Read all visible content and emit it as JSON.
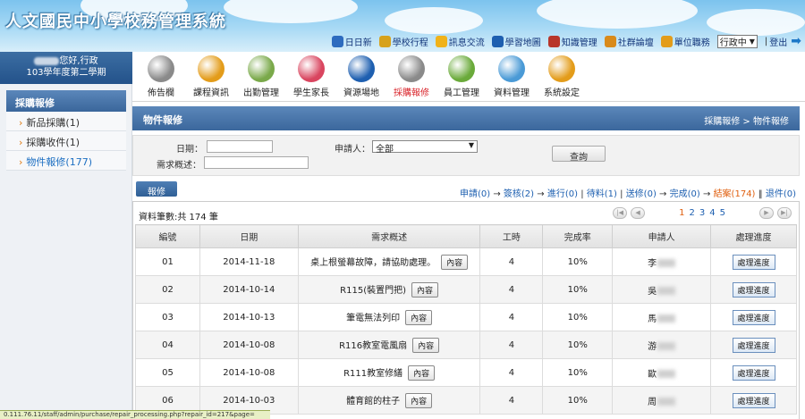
{
  "header": {
    "site_title": "人文國民中小學校務管理系統",
    "nav": [
      {
        "label": "日日新",
        "icon": "calendar-icon",
        "color": "#2d6bbf"
      },
      {
        "label": "學校行程",
        "icon": "school-schedule-icon",
        "color": "#d7a21c"
      },
      {
        "label": "訊息交流",
        "icon": "message-icon",
        "color": "#f0b21a"
      },
      {
        "label": "學習地圖",
        "icon": "globe-icon",
        "color": "#1e5fb0"
      },
      {
        "label": "知識管理",
        "icon": "book-icon",
        "color": "#b8362a"
      },
      {
        "label": "社群論壇",
        "icon": "pencil-icon",
        "color": "#d98a1a"
      },
      {
        "label": "單位職務",
        "icon": "gear-icon",
        "color": "#e39c1a"
      }
    ],
    "role_select": "行政中",
    "logout": "登出"
  },
  "user": {
    "greeting": "您好,行政",
    "semester": "103學年度第二學期"
  },
  "toolbar": [
    {
      "label": "佈告欄",
      "icon": "info-icon",
      "color": "#8a8a8a",
      "active": false
    },
    {
      "label": "課程資訊",
      "icon": "folder-icon",
      "color": "#e39c1a",
      "active": false
    },
    {
      "label": "出勤管理",
      "icon": "attendance-sheet-icon",
      "color": "#7aa94a",
      "active": false
    },
    {
      "label": "學生家長",
      "icon": "student-icon",
      "color": "#d9455f",
      "active": false
    },
    {
      "label": "資源場地",
      "icon": "globe-icon",
      "color": "#1e5fb0",
      "active": false
    },
    {
      "label": "採購報修",
      "icon": "wrench-icon",
      "color": "#8a8a8a",
      "active": true
    },
    {
      "label": "員工管理",
      "icon": "add-user-icon",
      "color": "#6aaa3a",
      "active": false
    },
    {
      "label": "資料管理",
      "icon": "computer-icon",
      "color": "#4a9ad6",
      "active": false
    },
    {
      "label": "系統設定",
      "icon": "gear-icon",
      "color": "#e39c1a",
      "active": false
    }
  ],
  "sidebar": {
    "heading": "採購報修",
    "items": [
      {
        "label": "新品採購(1)"
      },
      {
        "label": "採購收件(1)"
      },
      {
        "label": "物件報修(177)"
      }
    ]
  },
  "page": {
    "title": "物件報修",
    "breadcrumb": "採購報修 > 物件報修"
  },
  "search": {
    "date_label": "日期：",
    "desc_label": "需求概述：",
    "applicant_label": "申請人：",
    "applicant_value": "全部",
    "query_button": "查詢"
  },
  "actions": {
    "repair_button": "報修"
  },
  "flow": {
    "apply": "申請(0)",
    "review": "簽核(2)",
    "progress": "進行(0)",
    "pending": "待料(1)",
    "sent": "送修(0)",
    "complete": "完成(0)",
    "closed": "結案(174)",
    "returned": "退件(0)"
  },
  "list": {
    "count_text": "資料筆數:共 174 筆",
    "pages": [
      "1",
      "2",
      "3",
      "4",
      "5"
    ],
    "current_page": "1",
    "columns": [
      "編號",
      "日期",
      "需求概述",
      "工時",
      "完成率",
      "申請人",
      "處理進度"
    ],
    "detail_label": "內容",
    "process_label": "處理進度",
    "rows": [
      {
        "no": "01",
        "date": "2014-11-18",
        "desc": "桌上根螢幕故障，請協助處理。",
        "hours": "4",
        "rate": "10%",
        "applicant": "李"
      },
      {
        "no": "02",
        "date": "2014-10-14",
        "desc": "R115(裝置門把)",
        "hours": "4",
        "rate": "10%",
        "applicant": "吳"
      },
      {
        "no": "03",
        "date": "2014-10-13",
        "desc": "筆電無法列印",
        "hours": "4",
        "rate": "10%",
        "applicant": "馬"
      },
      {
        "no": "04",
        "date": "2014-10-08",
        "desc": "R116教室電風扇",
        "hours": "4",
        "rate": "10%",
        "applicant": "游"
      },
      {
        "no": "05",
        "date": "2014-10-08",
        "desc": "R111教室修繕",
        "hours": "4",
        "rate": "10%",
        "applicant": "歐"
      },
      {
        "no": "06",
        "date": "2014-10-03",
        "desc": "體育館的柱子",
        "hours": "4",
        "rate": "10%",
        "applicant": "周"
      }
    ]
  },
  "statusbar": {
    "url": "0.111.76.11/staff/admin/purchase/repair_processing.php?repair_id=217&page="
  }
}
